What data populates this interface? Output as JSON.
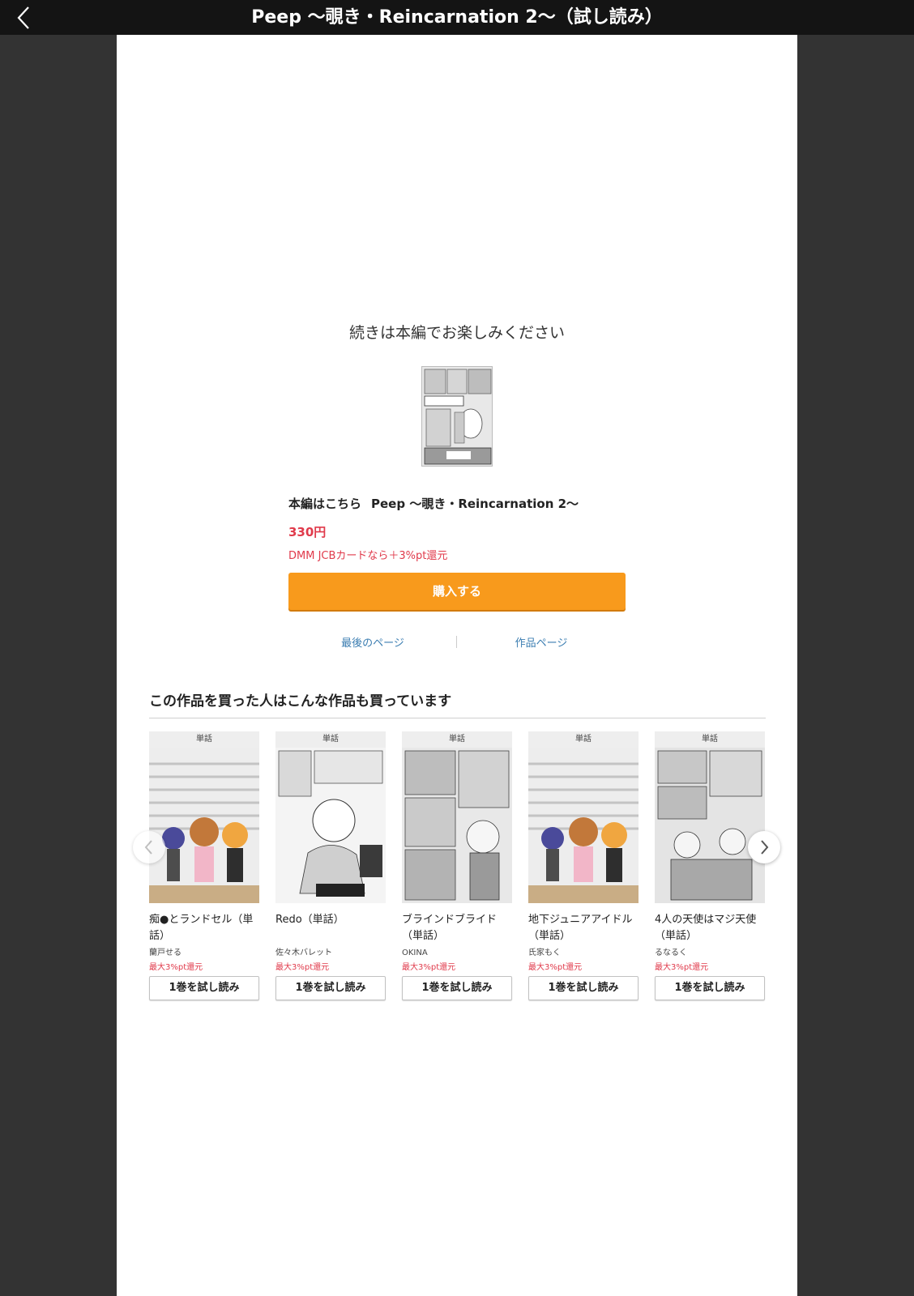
{
  "header": {
    "title": "Peep 〜覗き・Reincarnation 2〜（試し読み）",
    "back_icon": "chevron-left-icon"
  },
  "end": {
    "message": "続きは本編でお楽しみください",
    "main_label": "本編はこちら",
    "main_title": "Peep 〜覗き・Reincarnation 2〜",
    "price": "330円",
    "point_note": "DMM JCBカードなら＋3%pt還元",
    "buy_label": "購入する",
    "last_page_link": "最後のページ",
    "work_page_link": "作品ページ",
    "colors": {
      "accent": "#f89a1c",
      "price": "#e03a4b",
      "link": "#3b7db1"
    }
  },
  "recommendations": {
    "heading": "この作品を買った人はこんな作品も買っています",
    "items": [
      {
        "tag": "単話",
        "title": "痴●とランドセル（単話）",
        "author": "蘭戸せる",
        "points": "最大3%pt還元",
        "button": "1巻を試し読み"
      },
      {
        "tag": "単話",
        "title": "Redo（単話）",
        "author": "佐々木バレット",
        "points": "最大3%pt還元",
        "button": "1巻を試し読み"
      },
      {
        "tag": "単話",
        "title": "ブラインドブライド（単話）",
        "author": "OKINA",
        "points": "最大3%pt還元",
        "button": "1巻を試し読み"
      },
      {
        "tag": "単話",
        "title": "地下ジュニアアイドル（単話）",
        "author": "氏家もく",
        "points": "最大3%pt還元",
        "button": "1巻を試し読み"
      },
      {
        "tag": "単話",
        "title": "4人の天使はマジ天使（単話）",
        "author": "るなるく",
        "points": "最大3%pt還元",
        "button": "1巻を試し読み"
      }
    ]
  }
}
